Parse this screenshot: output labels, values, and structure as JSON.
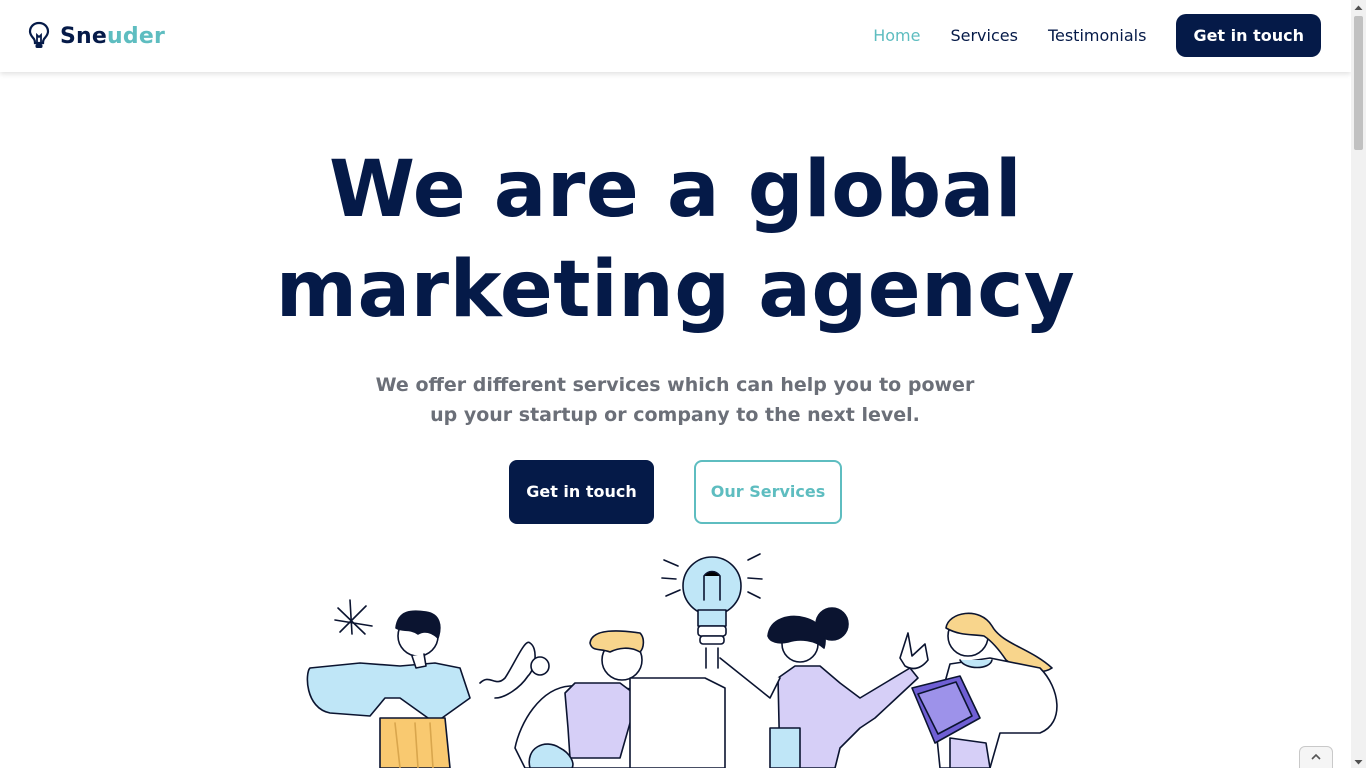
{
  "brand": {
    "name_part1": "Sne",
    "name_part2": "uder",
    "icon": "lightbulb-icon",
    "accent_color": "#5ebdc0",
    "primary_color": "#051a48"
  },
  "nav": {
    "items": [
      {
        "label": "Home",
        "active": true
      },
      {
        "label": "Services",
        "active": false
      },
      {
        "label": "Testimonials",
        "active": false
      }
    ],
    "cta_label": "Get in touch"
  },
  "hero": {
    "title_line1": "We are a global",
    "title_line2": "marketing agency",
    "subtitle_line1": "We offer different services which can help you to power",
    "subtitle_line2": "up your startup or company to the next level.",
    "primary_button": "Get in touch",
    "secondary_button": "Our Services",
    "illustration": "team-with-lightbulb-illustration"
  },
  "back_to_top": {
    "icon": "chevron-up-icon"
  }
}
